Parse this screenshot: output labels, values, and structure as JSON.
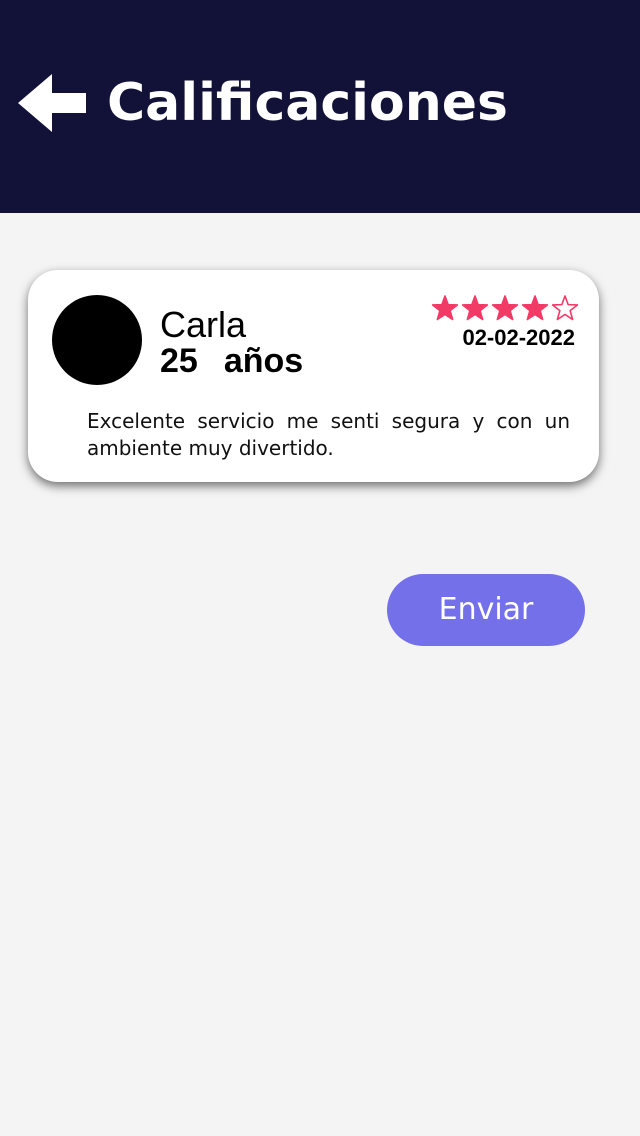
{
  "header": {
    "title": "Calificaciones",
    "back_icon": "arrow-left-icon",
    "background_color": "#121238"
  },
  "review": {
    "avatar": "avatar-circle",
    "name": "Carla",
    "age": "25",
    "age_unit": "años",
    "rating": 4,
    "rating_max": 5,
    "star_color": "#f23a67",
    "date": "02-02-2022",
    "text": "Excelente servicio me senti segura y con un ambiente muy divertido."
  },
  "actions": {
    "send_label": "Enviar",
    "send_color": "#7370ea"
  }
}
